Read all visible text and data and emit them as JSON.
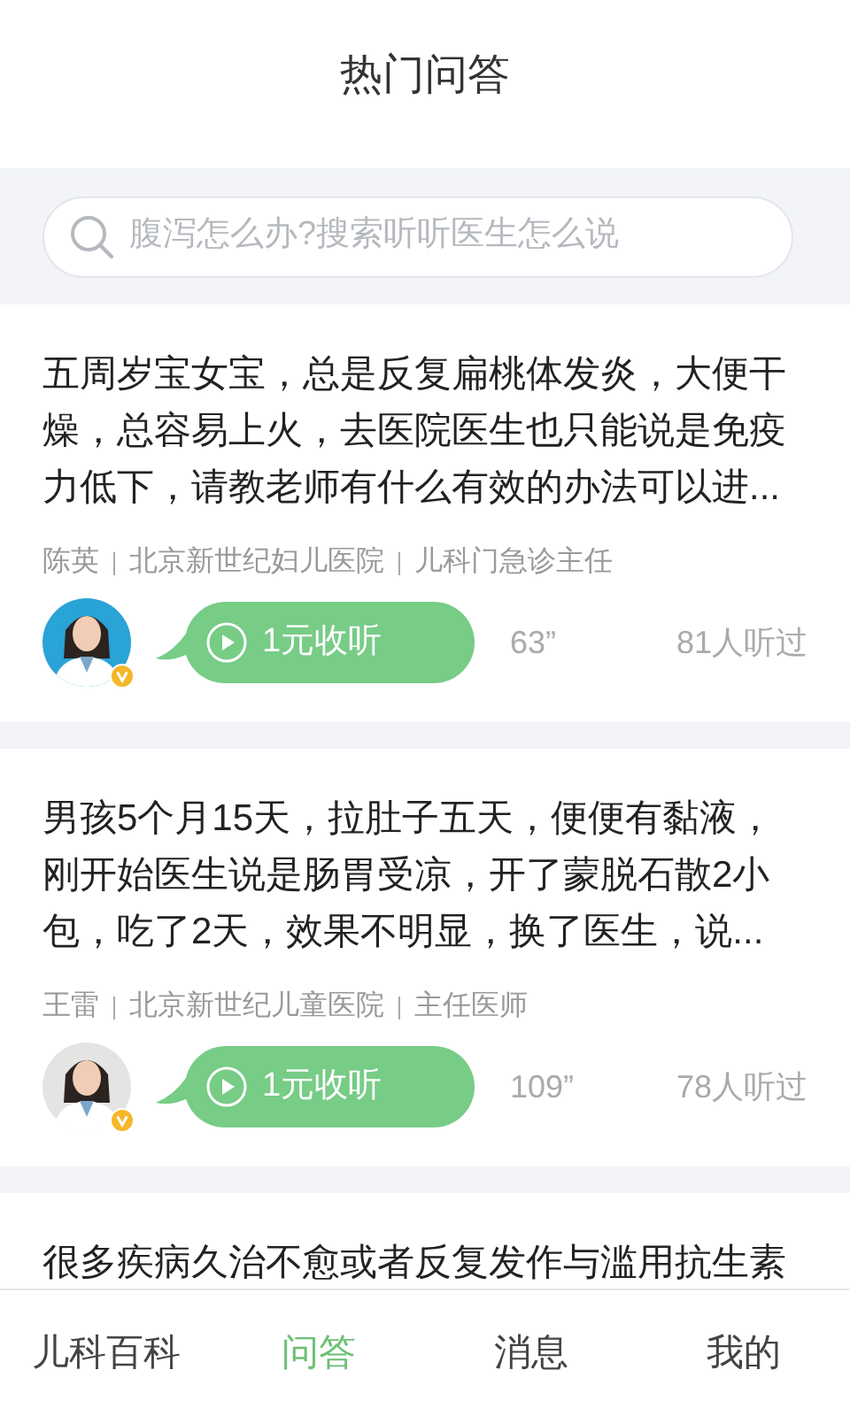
{
  "header": {
    "title": "热门问答"
  },
  "search": {
    "placeholder": "腹泻怎么办?搜索听听医生怎么说"
  },
  "questions": [
    {
      "text": "五周岁宝女宝，总是反复扁桃体发炎，大便干燥，总容易上火，去医院医生也只能说是免疫力低下，请教老师有什么有效的办法可以进...",
      "doctor": {
        "name": "陈英",
        "hospital": "北京新世纪妇儿医院",
        "title": "儿科门急诊主任",
        "verified": true
      },
      "price_label": "1元收听",
      "duration": "63”",
      "listeners": "81人听过"
    },
    {
      "text": "男孩5个月15天，拉肚子五天，便便有黏液，刚开始医生说是肠胃受凉，开了蒙脱石散2小包，吃了2天，效果不明显，换了医生，说...",
      "doctor": {
        "name": "王雷",
        "hospital": "北京新世纪儿童医院",
        "title": "主任医师",
        "verified": true
      },
      "price_label": "1元收听",
      "duration": "109”",
      "listeners": "78人听过"
    },
    {
      "text": "很多疾病久治不愈或者反复发作与滥用抗生素"
    }
  ],
  "tabs": [
    {
      "label": "儿科百科",
      "selected": false
    },
    {
      "label": "问答",
      "selected": true
    },
    {
      "label": "消息",
      "selected": false
    },
    {
      "label": "我的",
      "selected": false
    }
  ]
}
